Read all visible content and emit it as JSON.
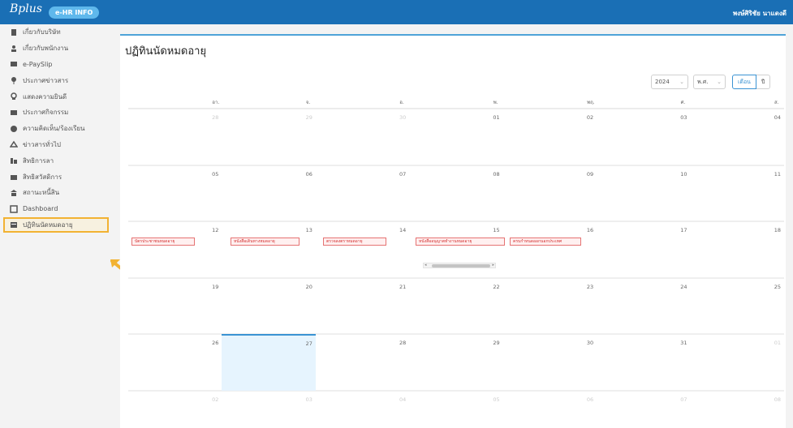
{
  "header": {
    "logo": "Bplus",
    "app_badge": "e-HR INFO",
    "user": "พงษ์ศิริชัย นาแดงดี"
  },
  "sidebar": {
    "items": [
      {
        "label": "เกี่ยวกับบริษัท",
        "icon": "building-icon"
      },
      {
        "label": "เกี่ยวกับพนักงาน",
        "icon": "person-icon"
      },
      {
        "label": "e-PaySlip",
        "icon": "payslip-icon"
      },
      {
        "label": "ประกาศข่าวสาร",
        "icon": "pin-icon"
      },
      {
        "label": "แสดงความยินดี",
        "icon": "congrats-icon"
      },
      {
        "label": "ประกาศกิจกรรม",
        "icon": "megaphone-icon"
      },
      {
        "label": "ความคิดเห็น/ร้องเรียน",
        "icon": "comment-icon"
      },
      {
        "label": "ข่าวสารทั่วไป",
        "icon": "news-icon"
      },
      {
        "label": "สิทธิการลา",
        "icon": "leave-icon"
      },
      {
        "label": "สิทธิสวัสดิการ",
        "icon": "welfare-icon"
      },
      {
        "label": "สถานะหนี้สิน",
        "icon": "bank-icon"
      },
      {
        "label": "Dashboard",
        "icon": "dashboard-icon"
      },
      {
        "label": "ปฏิทินนัดหมดอายุ",
        "icon": "calendar-icon",
        "active": true
      }
    ]
  },
  "main": {
    "title": "ปฏิทินนัดหมดอายุ",
    "controls": {
      "year": "2024",
      "era": "พ.ศ.",
      "view_month": "เดือน",
      "view_year": "ปี"
    },
    "weekdays": [
      "อา.",
      "จ.",
      "อ.",
      "พ.",
      "พฤ.",
      "ศ.",
      "ส."
    ],
    "weeks": [
      [
        {
          "d": "28",
          "m": true
        },
        {
          "d": "29",
          "m": true
        },
        {
          "d": "30",
          "m": true
        },
        {
          "d": "01"
        },
        {
          "d": "02"
        },
        {
          "d": "03"
        },
        {
          "d": "04"
        }
      ],
      [
        {
          "d": "05"
        },
        {
          "d": "06"
        },
        {
          "d": "07"
        },
        {
          "d": "08"
        },
        {
          "d": "09"
        },
        {
          "d": "10"
        },
        {
          "d": "11"
        }
      ],
      [
        {
          "d": "12"
        },
        {
          "d": "13"
        },
        {
          "d": "14"
        },
        {
          "d": "15"
        },
        {
          "d": "16"
        },
        {
          "d": "17"
        },
        {
          "d": "18"
        }
      ],
      [
        {
          "d": "19"
        },
        {
          "d": "20"
        },
        {
          "d": "21"
        },
        {
          "d": "22"
        },
        {
          "d": "23"
        },
        {
          "d": "24"
        },
        {
          "d": "25"
        }
      ],
      [
        {
          "d": "26"
        },
        {
          "d": "27",
          "today": true
        },
        {
          "d": "28"
        },
        {
          "d": "29"
        },
        {
          "d": "30"
        },
        {
          "d": "31"
        },
        {
          "d": "01",
          "m": true
        }
      ],
      [
        {
          "d": "02",
          "m": true
        },
        {
          "d": "03",
          "m": true
        },
        {
          "d": "04",
          "m": true
        },
        {
          "d": "05",
          "m": true
        },
        {
          "d": "06",
          "m": true
        },
        {
          "d": "07",
          "m": true
        },
        {
          "d": "08",
          "m": true
        }
      ]
    ],
    "events": [
      {
        "label": "บัตรประชาชนหมดอายุ"
      },
      {
        "label": "หนังสือเดินทางหมดอายุ"
      },
      {
        "label": "ตรวจลงตราหมดอายุ"
      },
      {
        "label": "หนังสืออนุญาตทำงานหมดอายุ"
      },
      {
        "label": "ครบกำหนดออกนอกประเทศ"
      }
    ]
  },
  "colors": {
    "topbar": "#1a6fb5",
    "accent": "#3a93d3",
    "highlight": "#f2b232",
    "event": "#d32f2f"
  }
}
